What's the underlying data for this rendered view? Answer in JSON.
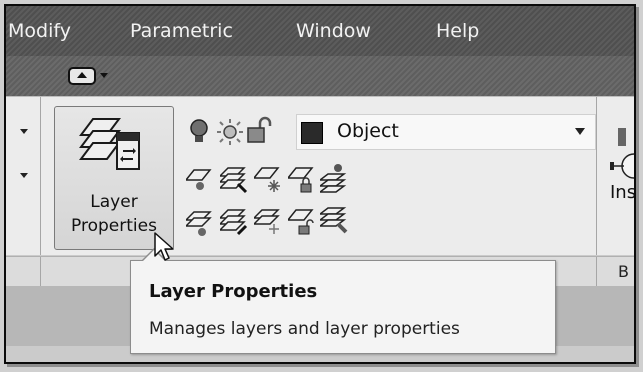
{
  "menu": {
    "items": [
      {
        "label": "Modify"
      },
      {
        "label": "Parametric"
      },
      {
        "label": "Window"
      },
      {
        "label": "Help"
      }
    ]
  },
  "qat": {
    "icon": "panel-toggle-icon"
  },
  "layers_panel": {
    "button_label_line1": "Layer",
    "button_label_line2": "Properties",
    "current_layer": "Object",
    "current_layer_color": "#2a2a2a"
  },
  "insert_panel": {
    "partial_label": "Ins",
    "footer_partial": "B"
  },
  "tooltip": {
    "title": "Layer Properties",
    "description": "Manages layers and layer properties"
  }
}
